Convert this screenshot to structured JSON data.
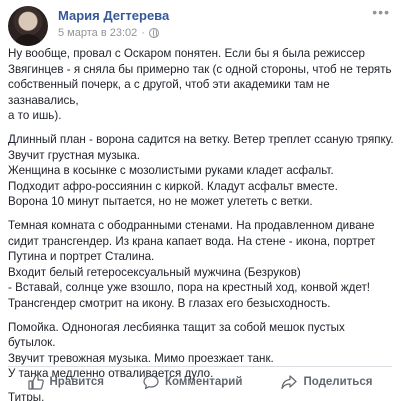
{
  "post": {
    "author": "Мария Дегтерева",
    "timestamp": "5 марта в 23:02",
    "privacy_icon": "globe-icon",
    "more_icon": "more-icon",
    "paragraphs": [
      "Ну вообще, провал с Оскаром понятен. Если бы я была режиссер\nЗвягинцев - я сняла бы примерно так (с одной стороны, чтоб не терять\nсобственный почерк, а с другой, чтоб эти академики там не зазнавались,\nа то ишь).",
      "Длинный план - ворона садится на ветку. Ветер треплет ссаную тряпку.\nЗвучит грустная музыка.\nЖенщина в косынке с мозолистыми руками кладет асфальт.\nПодходит афро-россиянин с киркой. Кладут асфальт вместе.\nВорона 10 минут пытается, но не может улететь с ветки.",
      "Темная комната с ободранными стенами. На продавленном диване\nсидит трансгендер. Из крана капает вода. На стене - икона, портрет\nПутина и портрет Сталина.\nВходит белый гетеросексуальный мужчина (Безруков)\n- Вставай, солнце уже взошло, пора на крестный ход, конвой ждет!\nТрансгендер смотрит на икону. В глазах его безысходность.",
      "Помойка. Одноногая лесбиянка тащит за собой мешок пустых бутылок.\nЗвучит тревожная музыка. Мимо проезжает танк.\nУ танка медленно отваливается дуло.",
      "Титры."
    ]
  },
  "actions": {
    "like_label": "Нравится",
    "comment_label": "Комментарий",
    "share_label": "Поделиться"
  },
  "colors": {
    "author_link": "#365899",
    "meta_text": "#90949c",
    "action_text": "#606770"
  }
}
